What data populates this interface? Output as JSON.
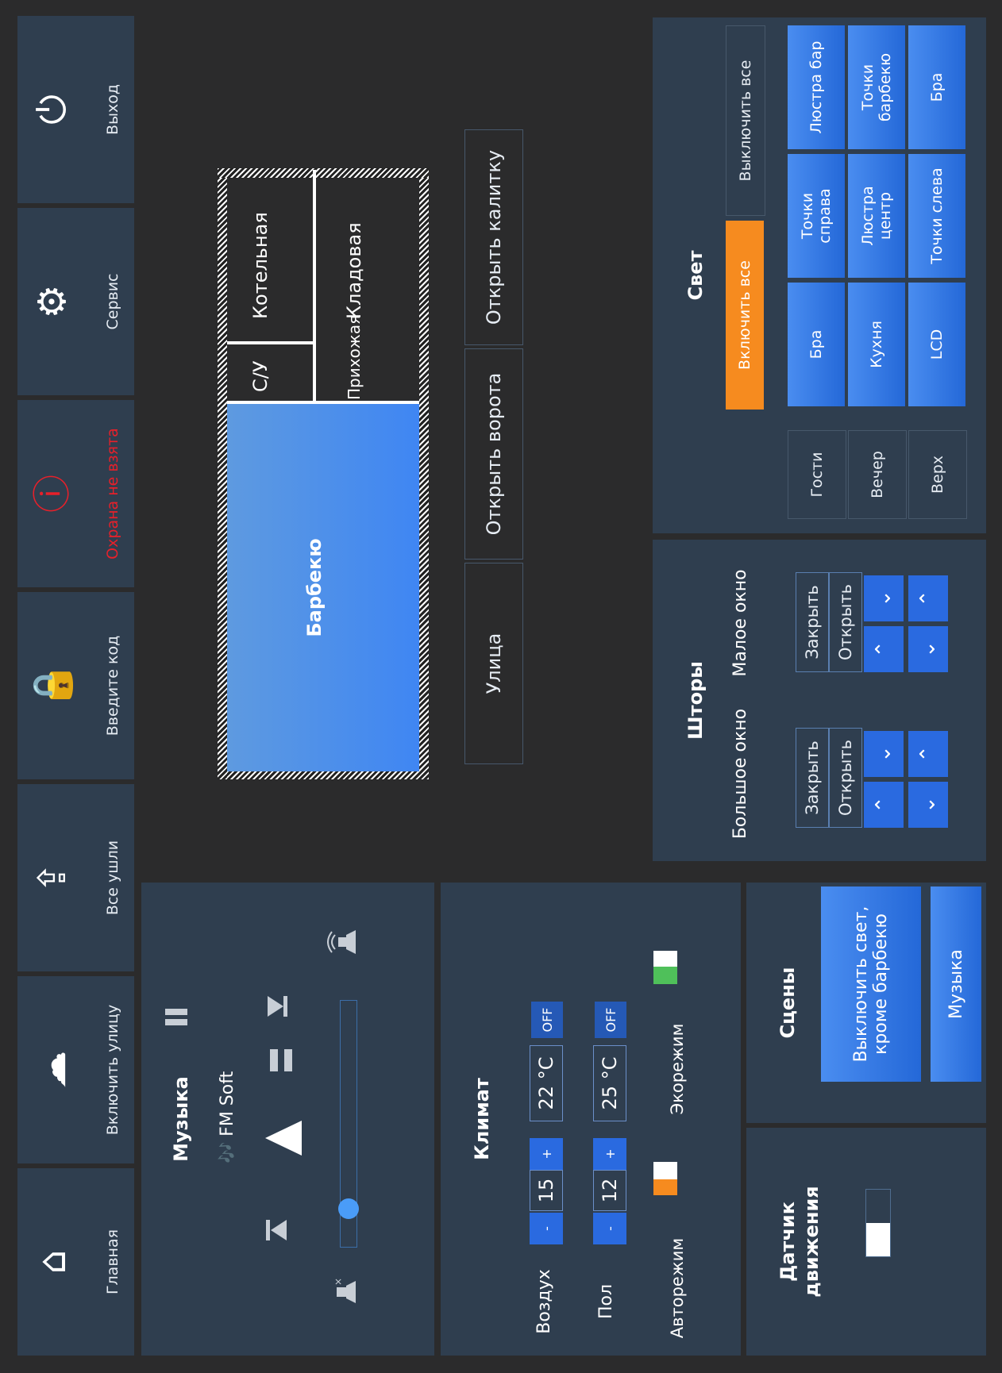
{
  "nav": [
    {
      "label": "Главная",
      "icon": "home-icon"
    },
    {
      "label": "Включить улицу",
      "icon": "weather-icon"
    },
    {
      "label": "Все ушли",
      "icon": "exit-share-icon"
    },
    {
      "label": "Введите код",
      "icon": "lock-icon"
    },
    {
      "label": "Охрана не взята",
      "icon": "alert-icon",
      "color": "#e8202a"
    },
    {
      "label": "Сервис",
      "icon": "gear-icon"
    },
    {
      "label": "Выход",
      "icon": "power-icon"
    }
  ],
  "music": {
    "title": "Музыка",
    "station": "FM Soft",
    "station_icon": "🎶"
  },
  "climate": {
    "title": "Климат",
    "air_label": "Воздух",
    "air_set": "15",
    "air_actual": "22 °C",
    "air_state": "OFF",
    "floor_label": "Пол",
    "floor_set": "12",
    "floor_actual": "25 °C",
    "floor_state": "OFF",
    "minus": "-",
    "plus": "+",
    "auto_label": "Авторежим",
    "eco_label": "Экорежим"
  },
  "motion": {
    "title_line1": "Датчик",
    "title_line2": "движения"
  },
  "scenes": {
    "title": "Сцены",
    "items": [
      "Выключить свет, кроме барбекю",
      "Музыка"
    ]
  },
  "plan": {
    "rooms": {
      "boiler": "Котельная",
      "pantry": "Кладовая",
      "wc": "С/У",
      "hall": "Прихожая",
      "bbq": "Барбекю"
    },
    "buttons": [
      "Улица",
      "Открыть ворота",
      "Открыть калитку"
    ]
  },
  "curtains": {
    "title": "Шторы",
    "big": "Большое окно",
    "small": "Малое окно",
    "close": "Закрыть",
    "open": "Открыть"
  },
  "light": {
    "title": "Свет",
    "all_on": "Включить все",
    "all_off": "Выключить все",
    "grid": [
      [
        "Люстра бар",
        "Точки справа",
        "Бра"
      ],
      [
        "Точки барбекю",
        "Люстра центр",
        "Кухня"
      ],
      [
        "Бра",
        "Точки слева",
        "LCD"
      ]
    ],
    "scenes": [
      "Гости",
      "Вечер",
      "Верх"
    ],
    "accent": "#f68b1f"
  }
}
